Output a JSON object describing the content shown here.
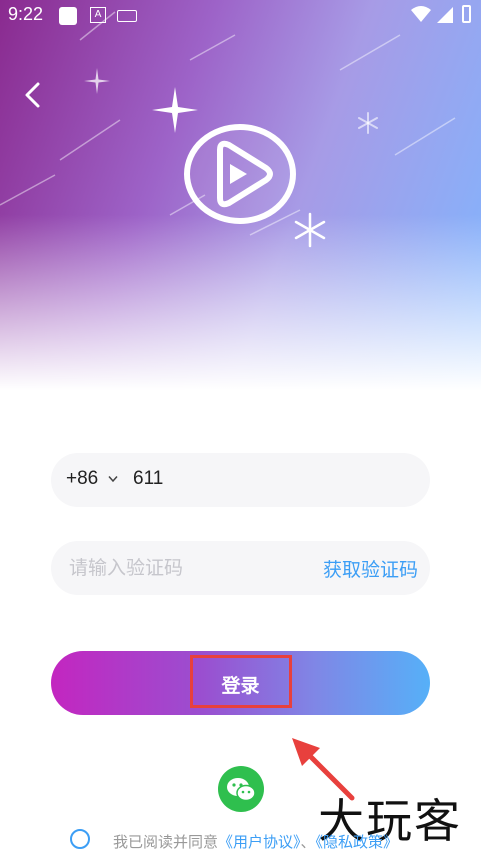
{
  "status_bar": {
    "time": "9:22"
  },
  "login": {
    "country_code": "+86",
    "phone_number": "611",
    "code_placeholder": "请输入验证码",
    "get_code_label": "获取验证码",
    "login_label": "登录"
  },
  "agreement": {
    "prefix": "我已阅读并同意",
    "user_agreement": "《用户协议》",
    "separator": "、",
    "privacy_policy": "《隐私政策》"
  },
  "watermark": "大玩客",
  "colors": {
    "accent_blue": "#3c9ef5",
    "gradient_start": "#c326c0",
    "gradient_end": "#56b0f8",
    "highlight_red": "#e8403d",
    "wechat_green": "#2fbf4e"
  },
  "icons": [
    "back-icon",
    "play-logo-icon",
    "sparkle-icon",
    "snowflake-icon",
    "chevron-down-icon",
    "wechat-icon",
    "radio-icon",
    "arrow-icon"
  ]
}
